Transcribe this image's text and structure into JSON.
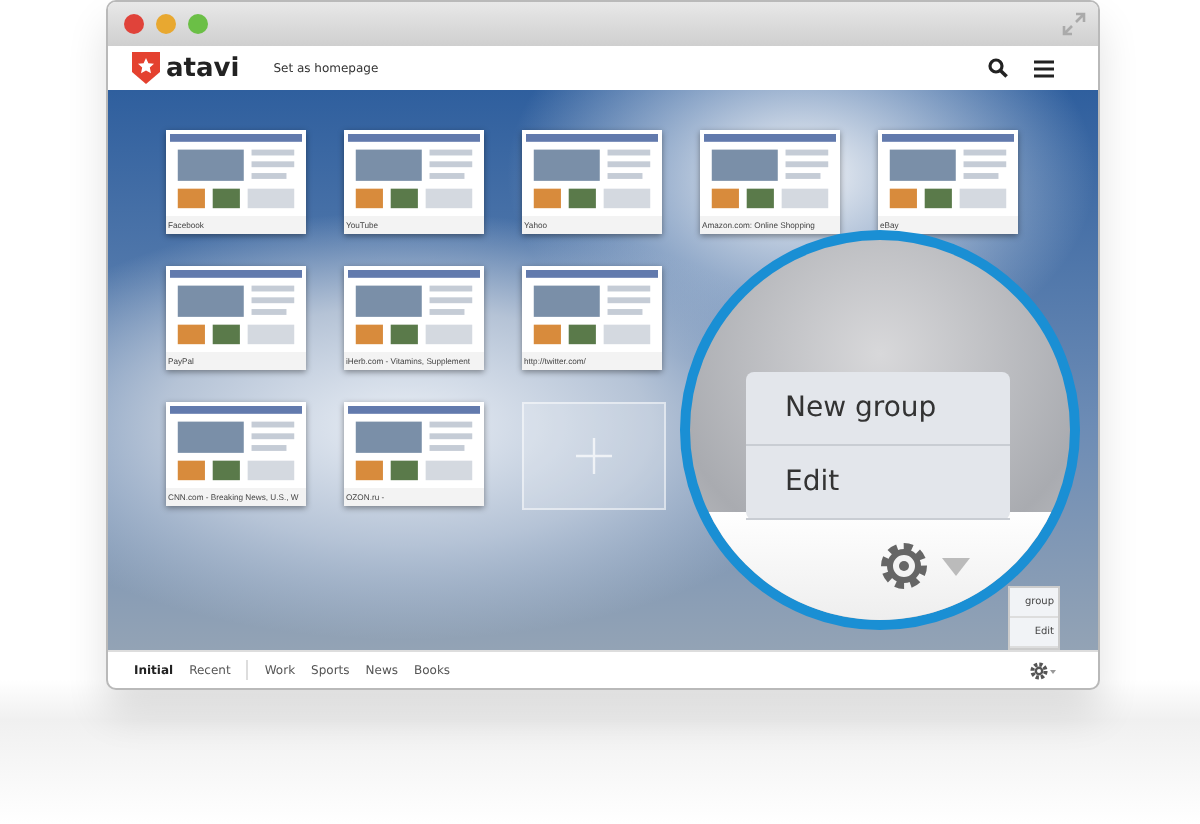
{
  "header": {
    "logo": "atavi",
    "homepage_link": "Set as homepage"
  },
  "tile_rows": [
    [
      {
        "kind": "site",
        "label": "Facebook"
      },
      {
        "kind": "site",
        "label": "YouTube"
      },
      {
        "kind": "site",
        "label": "Yahoo"
      },
      {
        "kind": "site",
        "label": "Amazon.com: Online Shopping"
      },
      {
        "kind": "site",
        "label": "eBay"
      }
    ],
    [
      {
        "kind": "site",
        "label": "PayPal"
      },
      {
        "kind": "site",
        "label": "iHerb.com - Vitamins, Supplement"
      },
      {
        "kind": "site",
        "label": "http://twitter.com/"
      }
    ],
    [
      {
        "kind": "site",
        "label": "CNN.com - Breaking News, U.S., W"
      },
      {
        "kind": "site",
        "label": "OZON.ru -"
      },
      {
        "kind": "add"
      }
    ]
  ],
  "small_menu": [
    "group",
    "Edit"
  ],
  "magnifier": {
    "menu": [
      "New group",
      "Edit"
    ]
  },
  "tabs": [
    {
      "label": "Initial",
      "selected": true
    },
    {
      "label": "Recent",
      "selected": false
    },
    {
      "label": "Work",
      "selected": false
    },
    {
      "label": "Sports",
      "selected": false
    },
    {
      "label": "News",
      "selected": false
    },
    {
      "label": "Books",
      "selected": false
    }
  ]
}
